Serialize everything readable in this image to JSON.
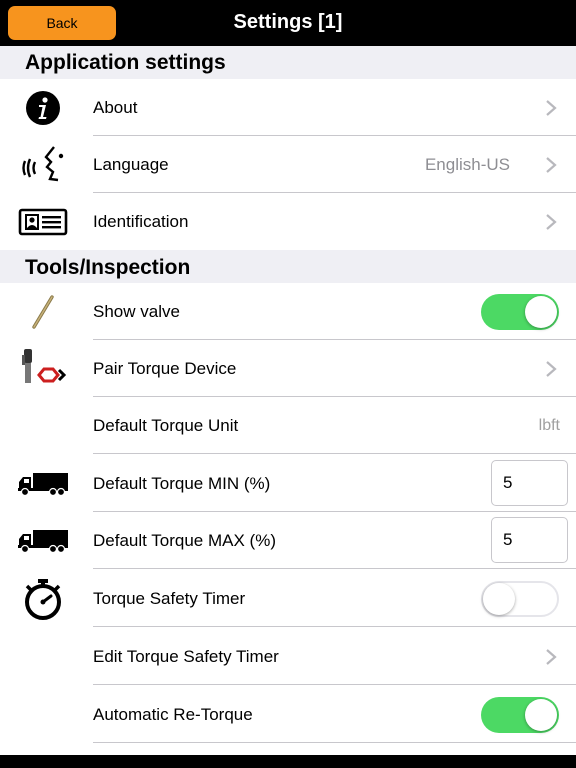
{
  "header": {
    "back_label": "Back",
    "title": "Settings [1]"
  },
  "colors": {
    "accent": "#f7941e",
    "toggle_on": "#4cd964",
    "section_bg": "#efeff4"
  },
  "sections": {
    "application": {
      "title": "Application settings",
      "rows": [
        {
          "label": "About",
          "icon": "info-icon"
        },
        {
          "label": "Language",
          "icon": "voice-icon",
          "detail": "English-US"
        },
        {
          "label": "Identification",
          "icon": "id-card-icon"
        }
      ]
    },
    "tools": {
      "title": "Tools/Inspection",
      "rows": [
        {
          "label": "Show valve",
          "icon": "valve-stem-icon",
          "toggle": true
        },
        {
          "label": "Pair Torque Device",
          "icon": "torque-device-icon"
        },
        {
          "label": "Default Torque Unit",
          "value": "lbft"
        },
        {
          "label": "Default Torque MIN (%)",
          "icon": "truck-icon",
          "value": "5"
        },
        {
          "label": "Default Torque MAX (%)",
          "icon": "truck-icon",
          "value": "5"
        },
        {
          "label": "Torque Safety Timer",
          "icon": "stopwatch-icon",
          "toggle": false
        },
        {
          "label": "Edit Torque Safety Timer"
        },
        {
          "label": "Automatic Re-Torque",
          "toggle": true
        }
      ]
    }
  }
}
